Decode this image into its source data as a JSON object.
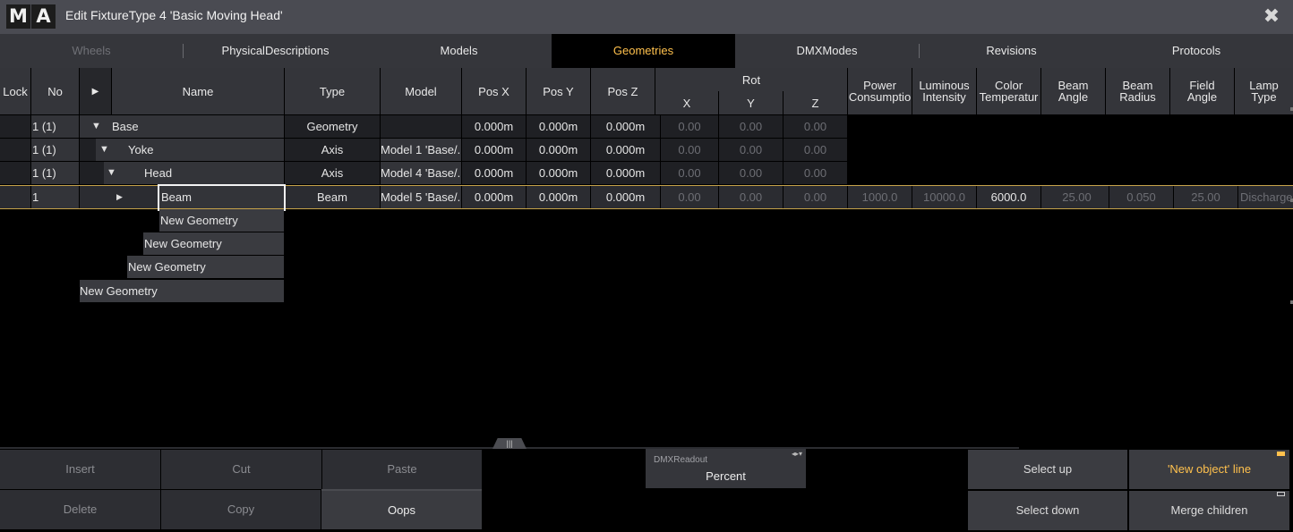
{
  "title": "Edit FixtureType 4 'Basic Moving Head'",
  "logo": [
    "M",
    "A"
  ],
  "tabs": [
    "Wheels",
    "PhysicalDescriptions",
    "Models",
    "Geometries",
    "DMXModes",
    "Revisions",
    "Protocols"
  ],
  "active_tab": "Geometries",
  "columns": {
    "lock": "Lock",
    "no": "No",
    "name": "Name",
    "type": "Type",
    "model": "Model",
    "pos_x": "Pos X",
    "pos_y": "Pos Y",
    "pos_z": "Pos Z",
    "rot": "Rot",
    "rot_x": "X",
    "rot_y": "Y",
    "rot_z": "Z",
    "power_1": "Power",
    "power_2": "Consumptio",
    "lum_1": "Luminous",
    "lum_2": "Intensity",
    "color_1": "Color",
    "color_2": "Temperatur",
    "beam_angle_1": "Beam",
    "beam_angle_2": "Angle",
    "beam_radius_1": "Beam",
    "beam_radius_2": "Radius",
    "field_1": "Field",
    "field_2": "Angle",
    "lamp_1": "Lamp",
    "lamp_2": "Type"
  },
  "rows": [
    {
      "no": "1 (1)",
      "name": "Base",
      "type": "Geometry",
      "model": "",
      "pos_x": "0.000m",
      "pos_y": "0.000m",
      "pos_z": "0.000m",
      "rx": "0.00",
      "ry": "0.00",
      "rz": "0.00"
    },
    {
      "no": "1 (1)",
      "name": "Yoke",
      "type": "Axis",
      "model": "Model 1 'Base/...",
      "pos_x": "0.000m",
      "pos_y": "0.000m",
      "pos_z": "0.000m",
      "rx": "0.00",
      "ry": "0.00",
      "rz": "0.00"
    },
    {
      "no": "1 (1)",
      "name": "Head",
      "type": "Axis",
      "model": "Model 4 'Base/...",
      "pos_x": "0.000m",
      "pos_y": "0.000m",
      "pos_z": "0.000m",
      "rx": "0.00",
      "ry": "0.00",
      "rz": "0.00"
    },
    {
      "no": "1",
      "name": "Beam",
      "type": "Beam",
      "model": "Model 5 'Base/...",
      "pos_x": "0.000m",
      "pos_y": "0.000m",
      "pos_z": "0.000m",
      "rx": "0.00",
      "ry": "0.00",
      "rz": "0.00",
      "power": "1000.0",
      "luminous": "10000.0",
      "color_temp": "6000.0",
      "beam_angle": "25.00",
      "beam_radius": "0.050",
      "field_angle": "25.00",
      "lamp_type": "Discharge"
    }
  ],
  "new_geometry": [
    "New Geometry",
    "New Geometry",
    "New Geometry",
    "New Geometry"
  ],
  "toolbar": {
    "insert": "Insert",
    "cut": "Cut",
    "paste": "Paste",
    "delete": "Delete",
    "copy": "Copy",
    "oops": "Oops",
    "dmx_readout_label": "DMXReadout",
    "dmx_readout_value": "Percent",
    "select_up": "Select up",
    "select_down": "Select down",
    "new_object_line": "'New object' line",
    "merge_children": "Merge children"
  },
  "colors": {
    "accent": "#ffc14d",
    "background": "#000000",
    "header": "#34353a"
  }
}
